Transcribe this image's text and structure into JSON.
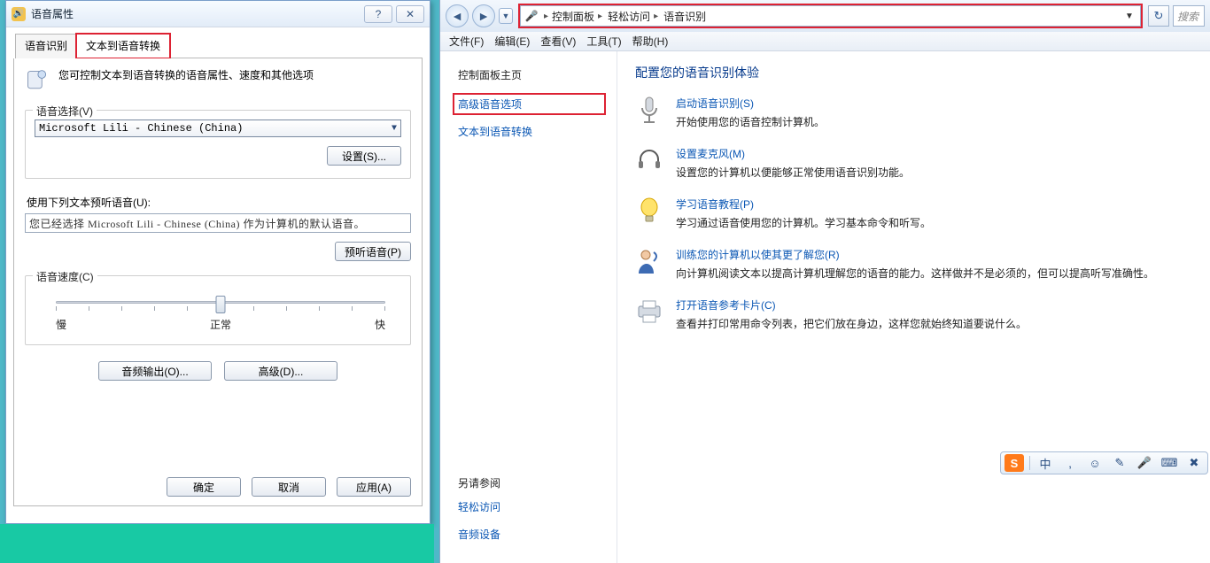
{
  "dialog": {
    "title": "语音属性",
    "help_glyph": "?",
    "close_glyph": "✕",
    "tabs": [
      "语音识别",
      "文本到语音转换"
    ],
    "active_tab": 1,
    "intro_text": "您可控制文本到语音转换的语音属性、速度和其他选项",
    "voice_select": {
      "legend": "语音选择(V)",
      "value": "Microsoft Lili - Chinese (China)",
      "settings_btn": "设置(S)..."
    },
    "preview": {
      "label": "使用下列文本预听语音(U):",
      "value": "您已经选择 Microsoft Lili - Chinese (China) 作为计算机的默认语音。",
      "preview_btn": "预听语音(P)"
    },
    "speed": {
      "legend": "语音速度(C)",
      "slow": "慢",
      "normal": "正常",
      "fast": "快"
    },
    "audio_out_btn": "音频输出(O)...",
    "advanced_btn": "高级(D)...",
    "ok_btn": "确定",
    "cancel_btn": "取消",
    "apply_btn": "应用(A)"
  },
  "cp": {
    "breadcrumbs": [
      "控制面板",
      "轻松访问",
      "语音识别"
    ],
    "search_placeholder": "搜索",
    "menus": [
      "文件(F)",
      "编辑(E)",
      "查看(V)",
      "工具(T)",
      "帮助(H)"
    ],
    "side": {
      "home": "控制面板主页",
      "adv": "高级语音选项",
      "tts": "文本到语音转换",
      "seealso_title": "另请参阅",
      "seealso": [
        "轻松访问",
        "音频设备"
      ]
    },
    "heading": "配置您的语音识别体验",
    "tasks": [
      {
        "title": "启动语音识别(S)",
        "desc": "开始使用您的语音控制计算机。"
      },
      {
        "title": "设置麦克风(M)",
        "desc": "设置您的计算机以便能够正常使用语音识别功能。"
      },
      {
        "title": "学习语音教程(P)",
        "desc": "学习通过语音使用您的计算机。学习基本命令和听写。"
      },
      {
        "title": "训练您的计算机以使其更了解您(R)",
        "desc": "向计算机阅读文本以提高计算机理解您的语音的能力。这样做并不是必须的，但可以提高听写准确性。"
      },
      {
        "title": "打开语音参考卡片(C)",
        "desc": "查看并打印常用命令列表，把它们放在身边，这样您就始终知道要说什么。"
      }
    ]
  },
  "tray": {
    "items": [
      "中",
      ",",
      "☺",
      "✎",
      "🎤",
      "⌨",
      "✖"
    ]
  }
}
